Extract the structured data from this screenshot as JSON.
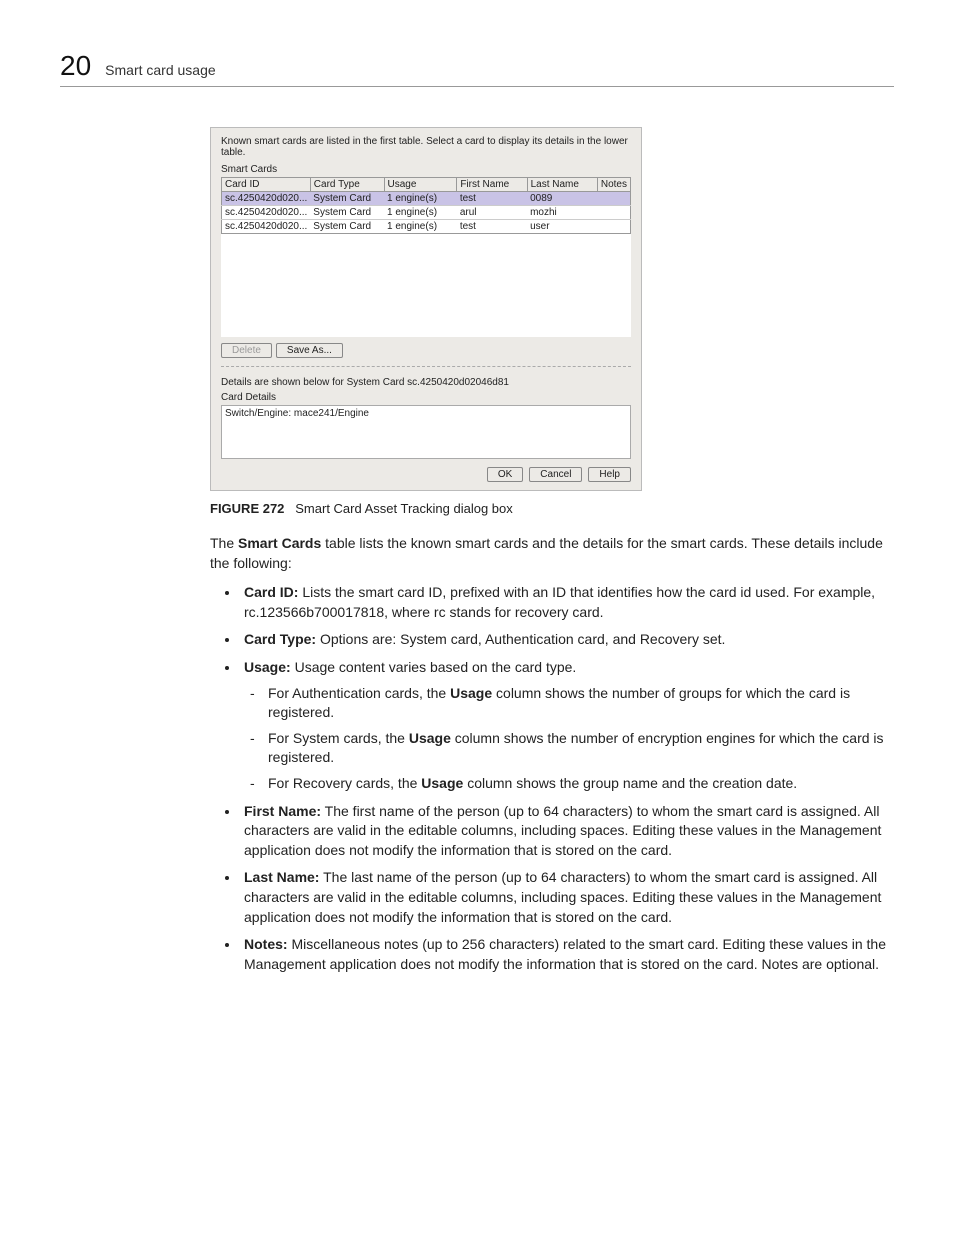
{
  "header": {
    "page_number": "20",
    "section": "Smart card usage"
  },
  "dialog": {
    "intro": "Known smart cards are listed in the first table. Select a card to display its details in the lower table.",
    "group_label": "Smart Cards",
    "columns": {
      "c1": "Card ID",
      "c2": "Card Type",
      "c3": "Usage",
      "c4": "First Name",
      "c5": "Last Name",
      "c6": "Notes"
    },
    "rows": [
      {
        "card_id": "sc.4250420d020...",
        "card_type": "System Card",
        "usage": "1 engine(s)",
        "first": "test",
        "last": "0089",
        "notes": "",
        "selected": true
      },
      {
        "card_id": "sc.4250420d020...",
        "card_type": "System Card",
        "usage": "1 engine(s)",
        "first": "arul",
        "last": "mozhi",
        "notes": "",
        "selected": false
      },
      {
        "card_id": "sc.4250420d020...",
        "card_type": "System Card",
        "usage": "1 engine(s)",
        "first": "test",
        "last": "user",
        "notes": "",
        "selected": false
      }
    ],
    "btn_delete": "Delete",
    "btn_saveas": "Save As...",
    "details_text": "Details are shown below for System Card sc.4250420d02046d81",
    "details_label": "Card Details",
    "detail_row": "Switch/Engine: mace241/Engine",
    "btn_ok": "OK",
    "btn_cancel": "Cancel",
    "btn_help": "Help"
  },
  "caption": {
    "label": "FIGURE 272",
    "text": "Smart Card Asset Tracking dialog box"
  },
  "para1_a": "The ",
  "para1_b": "Smart Cards",
  "para1_c": " table lists the known smart cards and the details for the smart cards. These details include the following:",
  "bullets": {
    "b1_label": "Card ID:",
    "b1_text": " Lists the smart card ID, prefixed with an ID that identifies how the card id used. For example, rc.123566b700017818, where rc stands for recovery card.",
    "b2_label": "Card Type:",
    "b2_text": " Options are: System card, Authentication card, and Recovery set.",
    "b3_label": "Usage:",
    "b3_text": " Usage content varies based on the card type.",
    "b3_s1a": "For Authentication cards, the ",
    "b3_s1b": "Usage",
    "b3_s1c": " column shows the number of groups for which the card is registered.",
    "b3_s2a": "For System cards, the ",
    "b3_s2b": "Usage",
    "b3_s2c": " column shows the number of encryption engines for which the card is registered.",
    "b3_s3a": "For Recovery cards, the ",
    "b3_s3b": "Usage",
    "b3_s3c": " column shows the group name and the creation date.",
    "b4_label": "First Name:",
    "b4_text": " The first name of the person (up to 64 characters) to whom the smart card is assigned. All characters are valid in the editable columns, including spaces. Editing these values in the Management application does not modify the information that is stored on the card.",
    "b5_label": "Last Name:",
    "b5_text": " The last name of the person (up to 64 characters) to whom the smart card is assigned. All characters are valid in the editable columns, including spaces. Editing these values in the Management application does not modify the information that is stored on the card.",
    "b6_label": "Notes:",
    "b6_text": " Miscellaneous notes (up to 256 characters) related to the smart card. Editing these values in the Management application does not modify the information that is stored on the card. Notes are optional."
  }
}
